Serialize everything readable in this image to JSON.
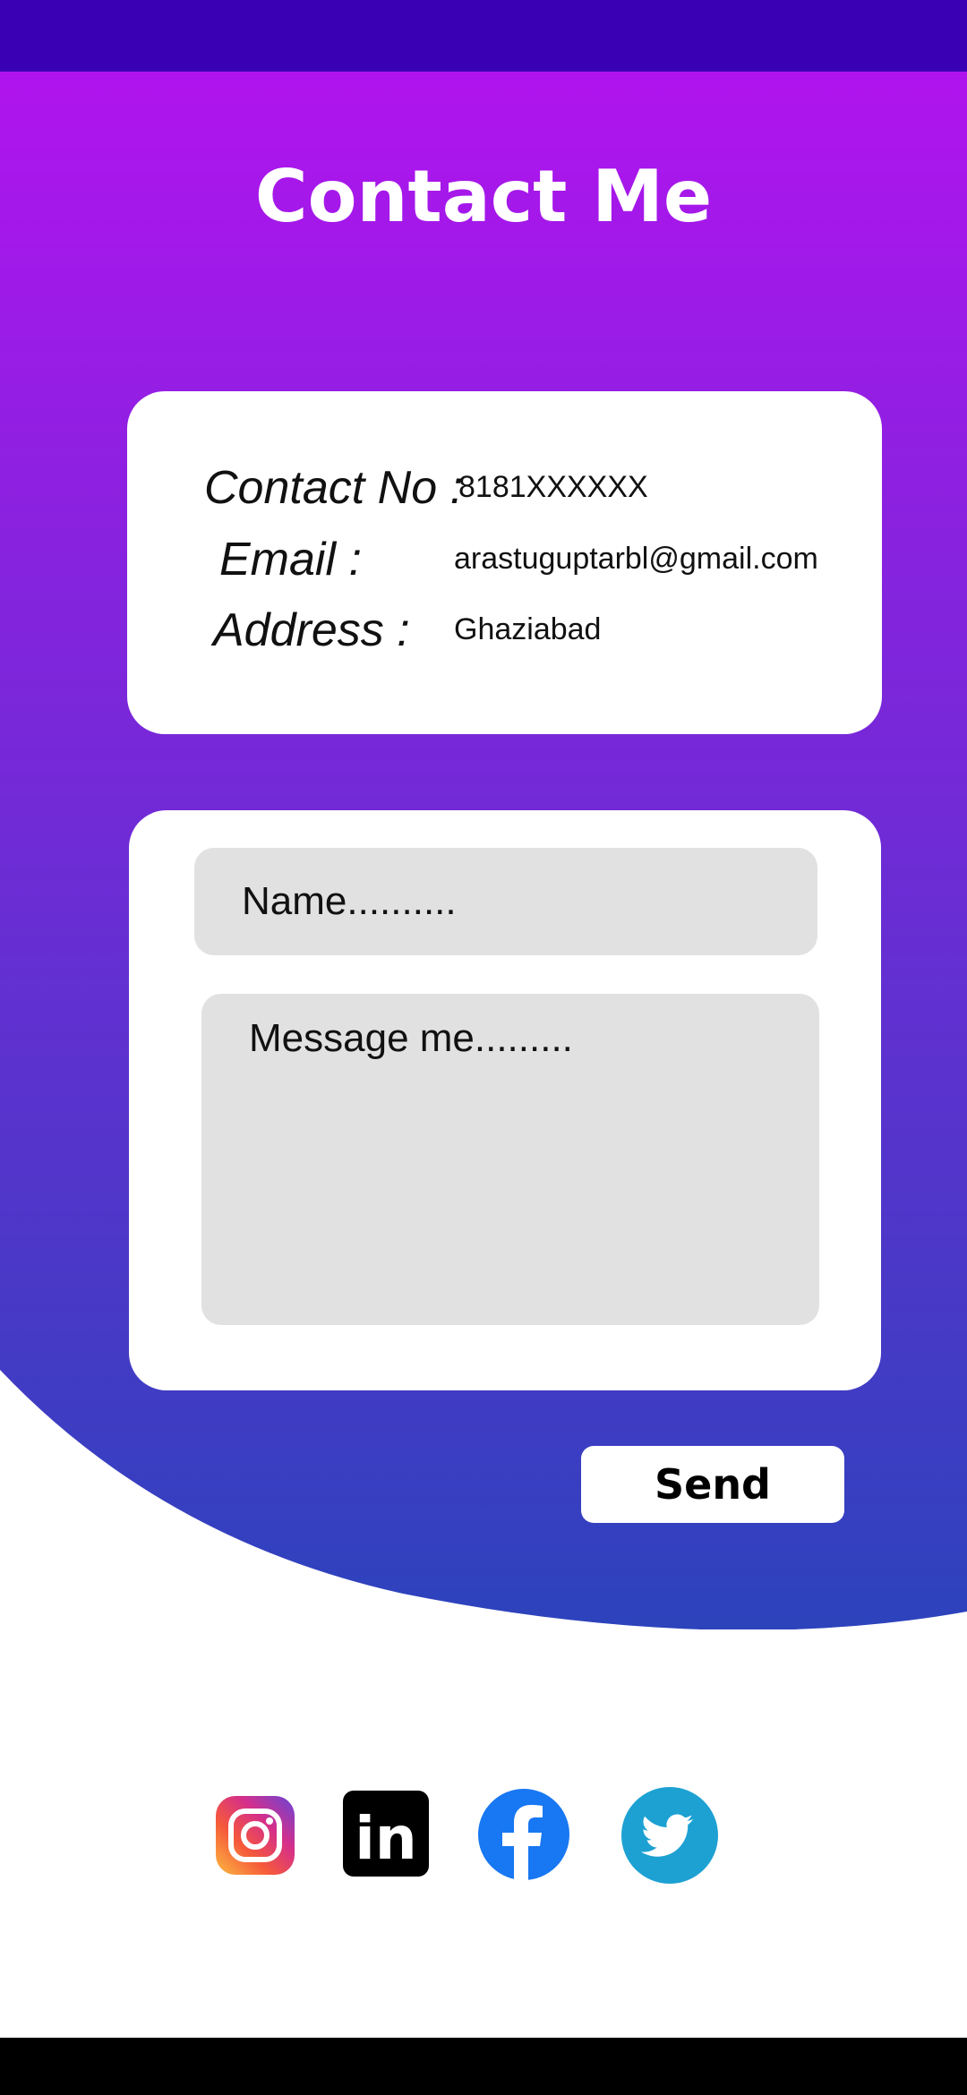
{
  "header": {
    "title": "Contact Me"
  },
  "contact_info": {
    "phone_label": "Contact No :",
    "phone_value": "8181XXXXXX",
    "email_label": "Email :",
    "email_value": "arastuguptarbl@gmail.com",
    "address_label": "Address :",
    "address_value": "Ghaziabad"
  },
  "form": {
    "name_placeholder": "Name..........",
    "message_placeholder": "Message me.........",
    "send_label": "Send"
  },
  "social": {
    "icons": [
      "instagram-icon",
      "linkedin-icon",
      "facebook-icon",
      "twitter-icon"
    ],
    "linkedin_text": "in"
  },
  "colors": {
    "gradient_top": "#b014ee",
    "gradient_bottom": "#2c43bc",
    "status_bar": "#3a00b3",
    "field_bg": "#e1e1e1"
  }
}
